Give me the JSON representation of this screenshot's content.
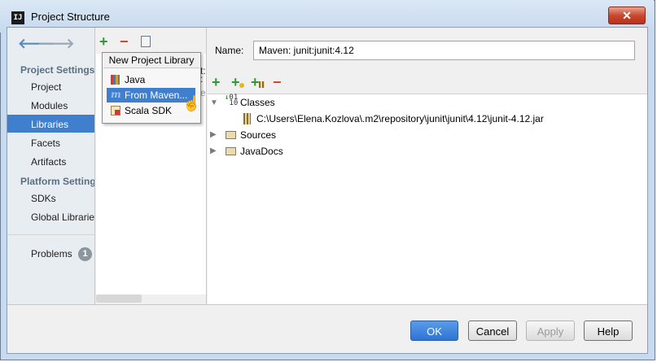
{
  "window": {
    "title": "Project Structure",
    "app_icon": "IJ",
    "close_label": "✕"
  },
  "nav": {
    "back_icon": "back-arrow-icon",
    "forward_icon": "forward-arrow-icon",
    "sections": [
      {
        "title": "Project Settings",
        "items": [
          "Project",
          "Modules",
          "Libraries",
          "Facets",
          "Artifacts"
        ]
      },
      {
        "title": "Platform Settings",
        "items": [
          "SDKs",
          "Global Libraries"
        ]
      }
    ],
    "selected": "Libraries",
    "problems": {
      "label": "Problems",
      "count": "1"
    }
  },
  "middle": {
    "toolbar": {
      "add": "+",
      "remove": "−"
    }
  },
  "popup": {
    "title": "New Project Library",
    "items": [
      "Java",
      "From Maven...",
      "Scala SDK"
    ],
    "selected": "From Maven..."
  },
  "library": {
    "name_label": "Name:",
    "name_value": "Maven: junit:junit:4.12",
    "toolbar": {
      "add": "+",
      "remove": "−"
    },
    "tree": {
      "classes": {
        "label": "Classes",
        "children": [
          "C:\\Users\\Elena.Kozlova\\.m2\\repository\\junit\\junit\\4.12\\junit-4.12.jar"
        ]
      },
      "sources": {
        "label": "Sources"
      },
      "javadocs": {
        "label": "JavaDocs"
      }
    }
  },
  "buttons": {
    "ok": "OK",
    "cancel": "Cancel",
    "apply": "Apply",
    "help": "Help"
  },
  "colors": {
    "selection": "#3f7fcd",
    "add": "#2f9a35",
    "remove": "#d64232"
  }
}
